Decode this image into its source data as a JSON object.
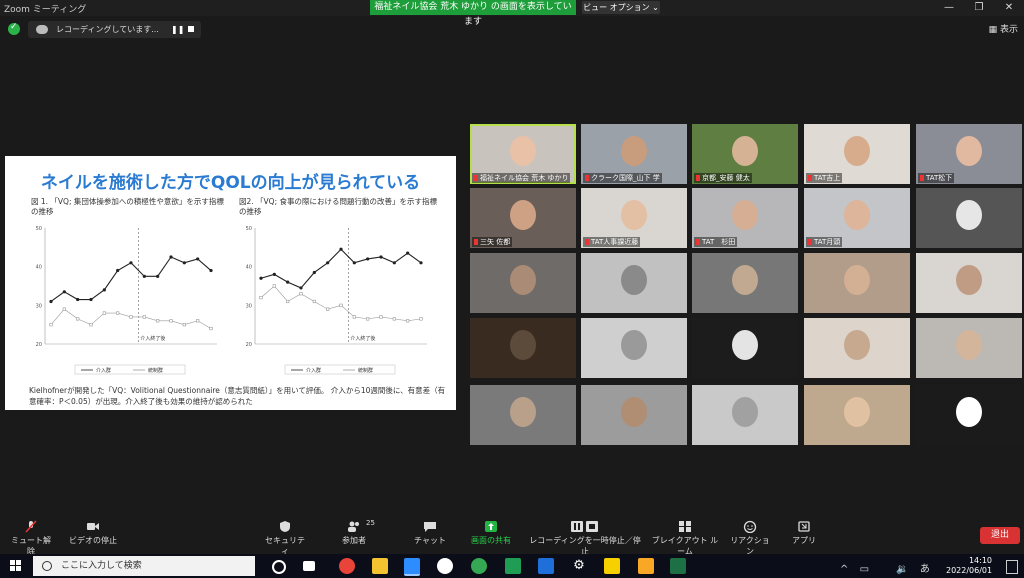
{
  "window": {
    "app_title": "Zoom ミーティング",
    "share_banner": "福祉ネイル協会 荒木 ゆかり の画面を表示しています",
    "view_options": "ビュー オプション ⌄",
    "display_button": "表示"
  },
  "recording": {
    "text": "レコーディングしています...",
    "pause_icon": "pause-icon",
    "stop_icon": "stop-icon"
  },
  "slide": {
    "title": "ネイルを施術した方でQOLの向上が見られている",
    "fig1_title": "図 1. 「VQ; 集団体操参加への積極性や意欲」を示す指標の推移",
    "fig2_title": "図2. 「VQ; 食事の際における問題行動の改善」を示す指標の推移",
    "note": "Kielhofnerが開発した「VQ：Volitional Questionnaire（意志質問紙）」を用いて評価。 介入から10週間後に、有意差（有意確率：P＜0.05）が出現。介入終了後も効果の維持が認められた",
    "end_label": "介入終了後",
    "legend": [
      "介入群",
      "統制群"
    ]
  },
  "chart_data": [
    {
      "type": "line",
      "title": "図 1. 「VQ; 集団体操参加への積極性や意欲」を示す指標の推移",
      "ylim": [
        20,
        50
      ],
      "y_ticks": [
        20,
        30,
        40,
        50
      ],
      "series": [
        {
          "name": "介入群",
          "values": [
            31,
            33.5,
            31.5,
            31.5,
            34,
            39,
            41,
            37.5,
            37.5,
            42.5,
            41,
            42,
            39
          ]
        },
        {
          "name": "統制群",
          "values": [
            25,
            29,
            26.5,
            25,
            28,
            28,
            27,
            27,
            26,
            26,
            25,
            26,
            24
          ]
        }
      ]
    },
    {
      "type": "line",
      "title": "図2. 「VQ; 食事の際における問題行動の改善」を示す指標の推移",
      "ylim": [
        20,
        50
      ],
      "y_ticks": [
        20,
        30,
        40,
        50
      ],
      "series": [
        {
          "name": "介入群",
          "values": [
            37,
            38,
            36,
            34.5,
            38.5,
            41,
            44.5,
            41,
            42,
            42.5,
            41,
            43.5,
            41
          ]
        },
        {
          "name": "統制群",
          "values": [
            32,
            35,
            31,
            33,
            31,
            29,
            30,
            27,
            26.5,
            27,
            26.5,
            26,
            26.5
          ]
        }
      ]
    }
  ],
  "participants": [
    {
      "name": "福祉ネイル協会 荒木 ゆかり",
      "active": true,
      "skin": "#e8c1a6",
      "bg": "#c9c3be"
    },
    {
      "name": "クラーク国際_山下 学",
      "skin": "#c89d7e",
      "bg": "#9aa1a8"
    },
    {
      "name": "京都_安藤 健太",
      "skin": "#d6b295",
      "bg": "#5f7e42"
    },
    {
      "name": "TAT吉上",
      "skin": "#d7ac8c",
      "bg": "#e0dad4"
    },
    {
      "name": "TAT松下",
      "skin": "#e0b9a0",
      "bg": "#8b8d96"
    },
    {
      "name": "三矢 佐都",
      "skin": "#cfa184",
      "bg": "#6a5f58"
    },
    {
      "name": "TAT人事課近藤",
      "skin": "#e3bfa3",
      "bg": "#d9d5d0"
    },
    {
      "name": "TAT　杉田",
      "skin": "#d6ae93",
      "bg": "#b7b7b9"
    },
    {
      "name": "TAT月頭",
      "skin": "#dcb59a",
      "bg": "#c4c5c9"
    },
    {
      "name": "",
      "skin": "#e6e6e6",
      "bg": "#555"
    },
    {
      "name": "",
      "skin": "#a98b76",
      "bg": "#6f6b68"
    },
    {
      "name": "",
      "skin": "#8a8a8a",
      "bg": "#c1c1c1"
    },
    {
      "name": "",
      "skin": "#c0a990",
      "bg": "#777"
    },
    {
      "name": "",
      "skin": "#d3b094",
      "bg": "#b19d8a"
    },
    {
      "name": "",
      "skin": "#bf9c83",
      "bg": "#d9d6d2"
    },
    {
      "name": "",
      "skin": "#5c4a3a",
      "bg": "#3a2b21"
    },
    {
      "name": "",
      "skin": "#9a9a9a",
      "bg": "#cfcfcf"
    },
    {
      "name": "",
      "skin": "#e4e4e4",
      "bg": "#1c1c1c"
    },
    {
      "name": "",
      "skin": "#c7a98f",
      "bg": "#ddd5cb"
    },
    {
      "name": "",
      "skin": "#d3b59c",
      "bg": "#bcb8b4"
    },
    {
      "name": "",
      "skin": "#b9a08a",
      "bg": "#7a7a7a"
    },
    {
      "name": "",
      "skin": "#b08e74",
      "bg": "#9c9c9c"
    },
    {
      "name": "",
      "skin": "#a1a1a1",
      "bg": "#c9c9c9"
    },
    {
      "name": "",
      "skin": "#e0c2a2",
      "bg": "#bfa98e"
    },
    {
      "name": "",
      "skin": "#ffffff",
      "bg": "#1b1b1b"
    }
  ],
  "toolbar": {
    "mute": "ミュート解除",
    "video": "ビデオの停止",
    "security": "セキュリティ",
    "participants": "参加者",
    "participants_count": "25",
    "chat": "チャット",
    "share": "画面の共有",
    "recording": "レコーディングを一時停止／停止",
    "breakout": "ブレイクアウト ルーム",
    "reactions": "リアクション",
    "apps": "アプリ",
    "leave": "退出"
  },
  "taskbar": {
    "search_placeholder": "ここに入力して検索",
    "time": "14:10",
    "date": "2022/06/01",
    "ime": "あ"
  }
}
